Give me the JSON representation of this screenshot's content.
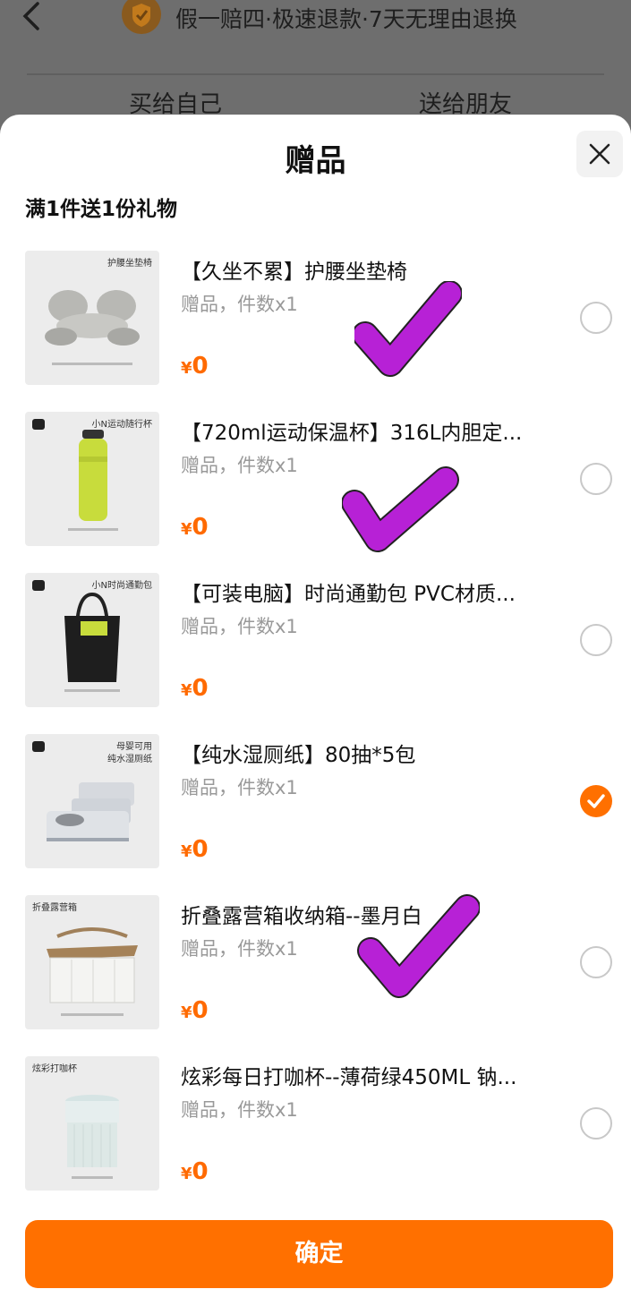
{
  "background_page": {
    "guarantee_text": "假一赔四·极速退款·7天无理由退换",
    "tabs": [
      "买给自己",
      "送给朋友"
    ]
  },
  "sheet": {
    "title": "赠品",
    "subtitle": "满1件送1份礼物",
    "confirm_label": "确定"
  },
  "gifts": [
    {
      "title": "【久坐不累】护腰坐垫椅",
      "meta": "赠品，件数x1",
      "currency": "¥",
      "price": "0",
      "selected": false,
      "thumb_label": "护腰坐垫椅"
    },
    {
      "title": "【720ml运动保温杯】316L内胆定...",
      "meta": "赠品，件数x1",
      "currency": "¥",
      "price": "0",
      "selected": false,
      "thumb_label": "小N运动随行杯"
    },
    {
      "title": "【可装电脑】时尚通勤包 PVC材质...",
      "meta": "赠品，件数x1",
      "currency": "¥",
      "price": "0",
      "selected": false,
      "thumb_label": "小N时尚通勤包"
    },
    {
      "title": "【纯水湿厕纸】80抽*5包",
      "meta": "赠品，件数x1",
      "currency": "¥",
      "price": "0",
      "selected": true,
      "thumb_label": "母婴可用\n纯水湿厕纸"
    },
    {
      "title": "折叠露营箱收纳箱--墨月白",
      "meta": "赠品，件数x1",
      "currency": "¥",
      "price": "0",
      "selected": false,
      "thumb_label": "折叠露营箱"
    },
    {
      "title": "炫彩每日打咖杯--薄荷绿450ML 钠...",
      "meta": "赠品，件数x1",
      "currency": "¥",
      "price": "0",
      "selected": false,
      "thumb_label": "炫彩打咖杯"
    }
  ],
  "colors": {
    "accent": "#ff7000",
    "price": "#ff6a00",
    "annotation_check": "#b721d6"
  },
  "icons": {
    "back": "chevron-left-icon",
    "guarantee": "shield-check-icon",
    "close": "close-icon",
    "selected": "checkmark-icon"
  }
}
